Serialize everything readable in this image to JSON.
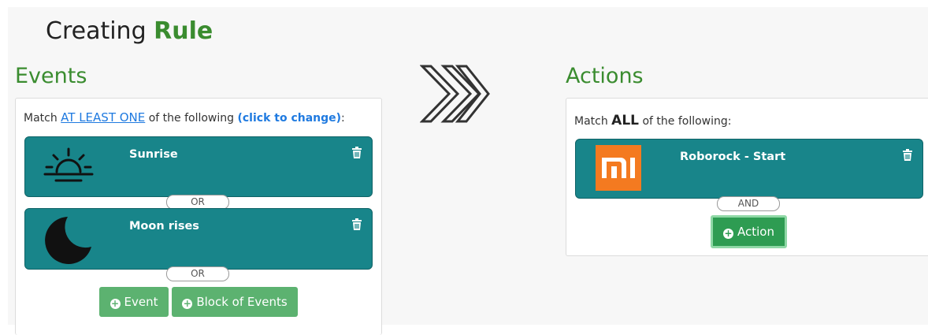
{
  "page": {
    "title_prefix": "Creating",
    "title_accent": "Rule"
  },
  "events": {
    "heading": "Events",
    "match_prefix": "Match",
    "match_mode": "AT LEAST ONE",
    "match_suffix": "of the following",
    "change_hint": "(click to change)",
    "match_colon": ":",
    "items": [
      {
        "label": "Sunrise",
        "icon": "sunrise-icon"
      },
      {
        "label": "Moon rises",
        "icon": "moon-icon"
      }
    ],
    "connector_label": "OR",
    "add_event_label": "Event",
    "add_block_label": "Block of Events"
  },
  "actions": {
    "heading": "Actions",
    "match_prefix": "Match",
    "match_mode": "ALL",
    "match_suffix": "of the following:",
    "items": [
      {
        "label": "Roborock - Start",
        "icon": "xiaomi-mi-logo"
      }
    ],
    "connector_label": "AND",
    "add_action_label": "Action"
  },
  "colors": {
    "accent_green": "#3a8c2f",
    "card_teal": "#18858a",
    "button_green": "#5cb270",
    "link_blue": "#1f7ae0",
    "xiaomi_orange": "#f47a20"
  }
}
